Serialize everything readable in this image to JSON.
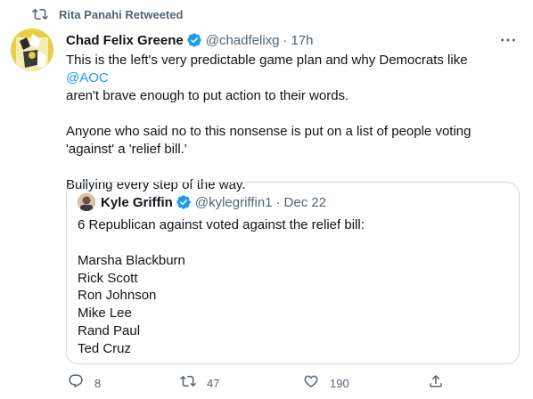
{
  "retweet_banner": {
    "label": "Rita Panahi Retweeted",
    "icon": "retweet-icon"
  },
  "tweet": {
    "author_name": "Chad Felix Greene",
    "author_handle": "@chadfelixg",
    "separator": "·",
    "timestamp": "17h",
    "body": {
      "p1_a": "This is the left's very predictable game plan and why Democrats like ",
      "p1_mention": "@AOC",
      "p1_b": "aren't brave enough to put action to their words.",
      "p2_a": "Anyone who said no to this nonsense is put on a list of people voting",
      "p2_b": "'against' a 'relief bill.'",
      "p3": "Bullying every step of the way."
    }
  },
  "quote": {
    "author_name": "Kyle Griffin",
    "author_handle": "@kylegriffin1",
    "separator": "·",
    "date": "Dec 22",
    "text": "6 Republican against voted against the relief bill:",
    "names": [
      "Marsha Blackburn",
      "Rick Scott",
      "Ron Johnson",
      "Mike Lee",
      "Rand Paul",
      "Ted Cruz"
    ]
  },
  "actions": {
    "reply_count": "8",
    "retweet_count": "47",
    "like_count": "190"
  },
  "colors": {
    "accent": "#1d9bf0",
    "secondary_text": "#536471",
    "border": "#cfd9de"
  }
}
